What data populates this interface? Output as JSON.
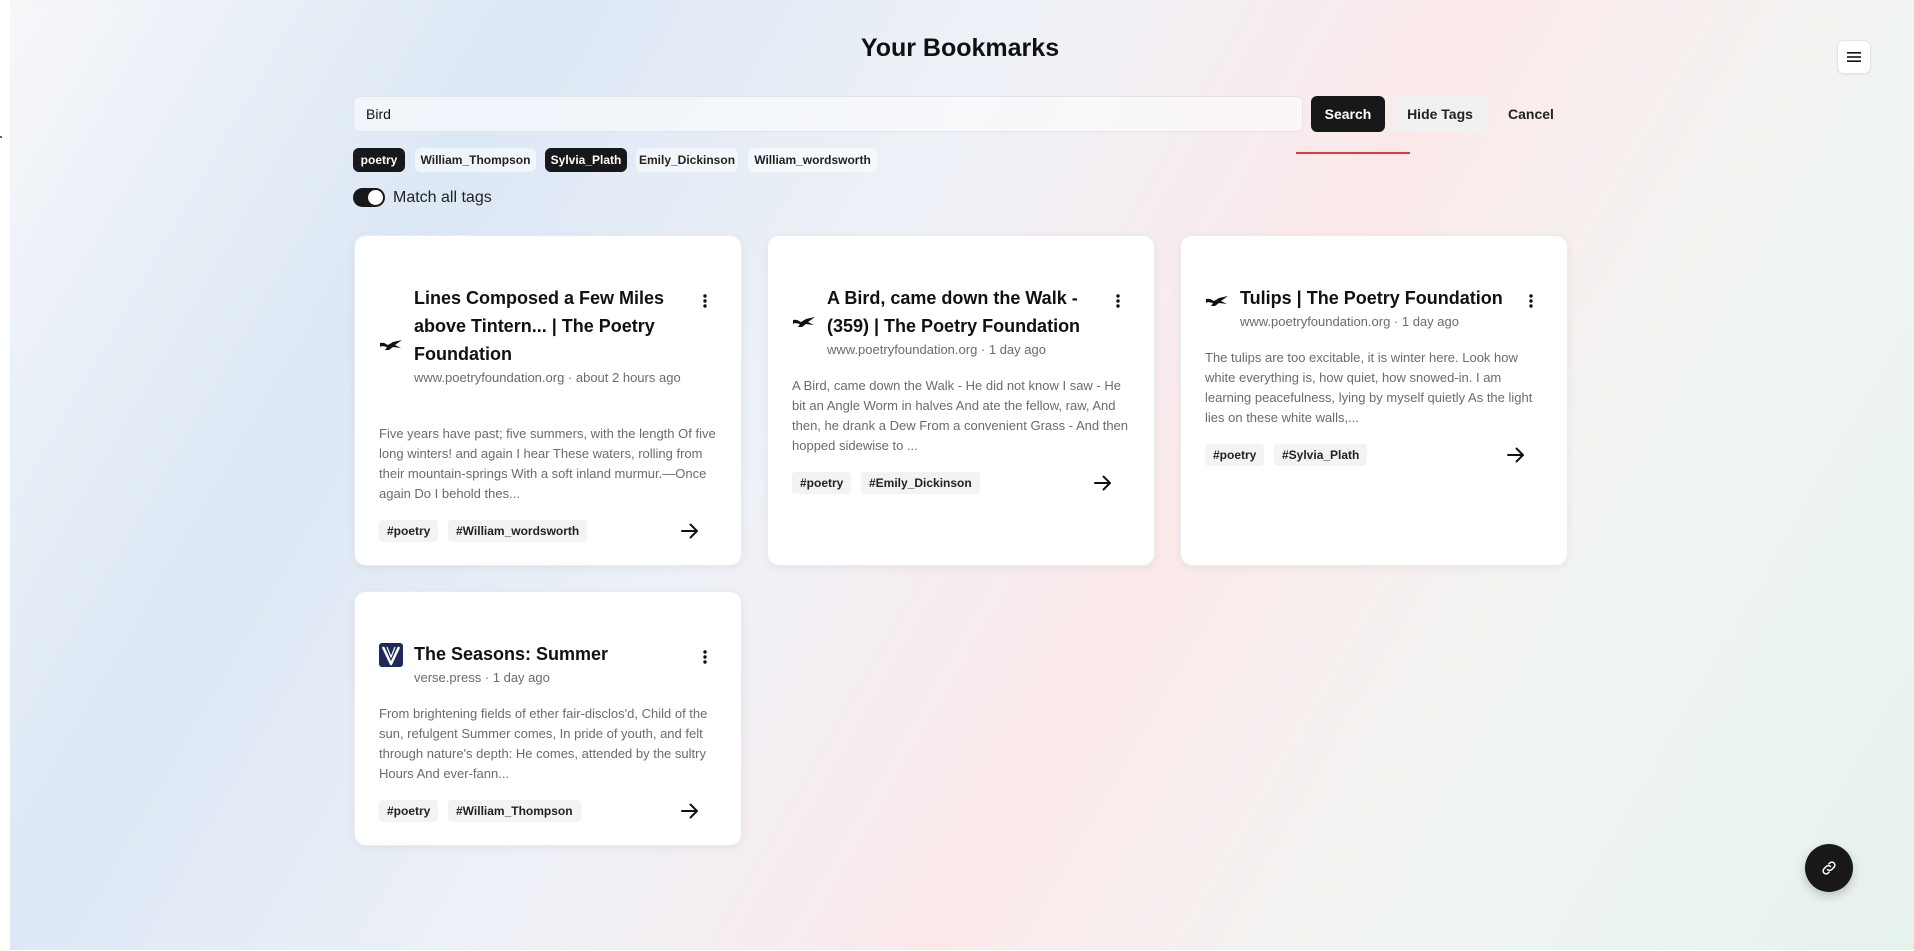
{
  "header": {
    "title": "Your Bookmarks",
    "menu_icon": "hamburger-icon"
  },
  "search": {
    "value": "Bird",
    "search_label": "Search",
    "hide_tags_label": "Hide Tags",
    "cancel_label": "Cancel"
  },
  "tags": [
    {
      "label": "poetry",
      "active": true
    },
    {
      "label": "William_Thompson",
      "active": false
    },
    {
      "label": "Sylvia_Plath",
      "active": true
    },
    {
      "label": "Emily_Dickinson",
      "active": false
    },
    {
      "label": "William_wordsworth",
      "active": false
    }
  ],
  "match_all": {
    "label": "Match all tags",
    "on": true
  },
  "cards": [
    {
      "title": "Lines Composed a Few Miles above Tintern... | The Poetry Foundation",
      "meta": "www.poetryfoundation.org · about 2 hours ago",
      "description": "Five years have past; five summers, with the length Of five long winters! and again I hear These waters, rolling from their mountain-springs With a soft inland murmur.—Once again Do I behold thes...",
      "tags": [
        "#poetry",
        "#William_wordsworth"
      ],
      "favicon": "bird-icon"
    },
    {
      "title": "A Bird, came down the Walk - (359) | The Poetry Foundation",
      "meta": "www.poetryfoundation.org · 1 day ago",
      "description": "A Bird, came down the Walk - He did not know I saw - He bit an Angle Worm in halves And ate the fellow, raw, And then, he drank a Dew From a convenient Grass - And then hopped sidewise to ...",
      "tags": [
        "#poetry",
        "#Emily_Dickinson"
      ],
      "favicon": "bird-icon"
    },
    {
      "title": "Tulips | The Poetry Foundation",
      "meta": "www.poetryfoundation.org · 1 day ago",
      "description": "The tulips are too excitable, it is winter here. Look how white everything is, how quiet, how snowed-in. I am learning peacefulness, lying by myself quietly As the light lies on these white walls,...",
      "tags": [
        "#poetry",
        "#Sylvia_Plath"
      ],
      "favicon": "bird-icon"
    },
    {
      "title": "The Seasons: Summer",
      "meta": "verse.press · 1 day ago",
      "description": "From brightening fields of ether fair-disclos'd, Child of the sun, refulgent Summer comes, In pride of youth, and felt through nature's depth: He comes, attended by the sultry Hours And ever-fann...",
      "tags": [
        "#poetry",
        "#William_Thompson"
      ],
      "favicon": "verse-logo-icon"
    }
  ],
  "fab": {
    "icon": "link-icon"
  }
}
